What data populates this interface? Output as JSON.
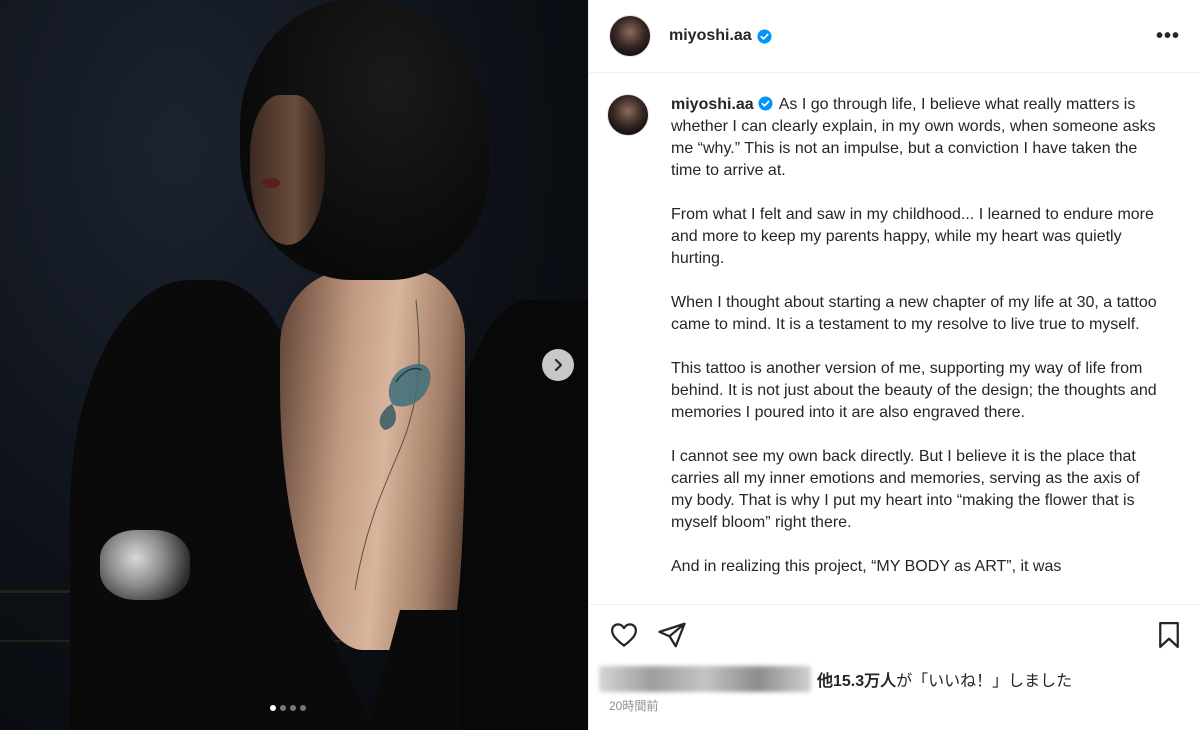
{
  "post": {
    "username": "miyoshi.aa",
    "verified": true,
    "more_label": "•••",
    "caption_paragraphs": [
      "As I go through life, I believe what really matters is whether I can clearly explain, in my own words, when someone asks me “why.”  This is not an impulse, but a conviction I have taken the time to arrive at.",
      "From what I felt and saw in my childhood... I learned to endure more and more to keep my parents happy, while my heart was quietly hurting.",
      "When I thought about starting a new chapter of my life at 30, a tattoo came to mind. It is a testament to my resolve to live true to myself.",
      "This tattoo is another version of me, supporting my way of life from behind. It is not just about the beauty of the design; the thoughts and memories I poured into it are also engraved there.",
      "I cannot see my own back directly. But I believe it is the place that carries all my inner emotions and memories, serving as the axis of my body. That is why I put my heart into “making the flower that is myself bloom” right there.",
      "And in realizing this project, “MY BODY as ART”, it was"
    ],
    "likes_count": "他15.3万人",
    "likes_suffix": "が「いいね！」しました",
    "timestamp": "20時間前",
    "carousel": {
      "total": 4,
      "active_index": 0
    }
  },
  "icons": {
    "next": "chevron-right-icon",
    "like": "heart-icon",
    "share": "send-icon",
    "save": "bookmark-icon",
    "verified": "verified-badge-icon"
  },
  "colors": {
    "verified": "#0095f6",
    "text": "#262626",
    "muted": "#8e8e8e"
  }
}
